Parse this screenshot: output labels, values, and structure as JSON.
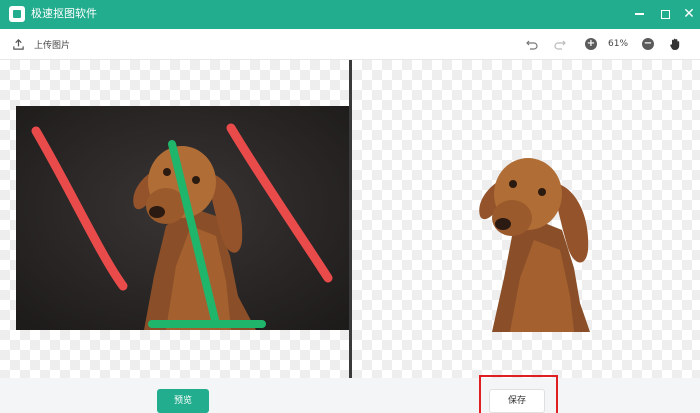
{
  "window": {
    "title": "极速抠图软件",
    "icons": [
      "app-logo",
      "minimize",
      "maximize",
      "close"
    ],
    "brand_color": "#22ad8e"
  },
  "toolbar": {
    "upload_label": "上传图片",
    "zoom_level": "61%",
    "icons": [
      "upload-icon",
      "undo-icon",
      "redo-icon",
      "zoom-in-icon",
      "zoom-out-icon",
      "hand-icon"
    ]
  },
  "canvas": {
    "left_panel": "original photo of a brown dog with red (background) and green (foreground) brush strokes",
    "right_panel": "cutout result of the dog on transparent checkerboard background"
  },
  "footer": {
    "preview_label": "预览",
    "save_label": "保存",
    "highlight_color": "#e02020"
  }
}
